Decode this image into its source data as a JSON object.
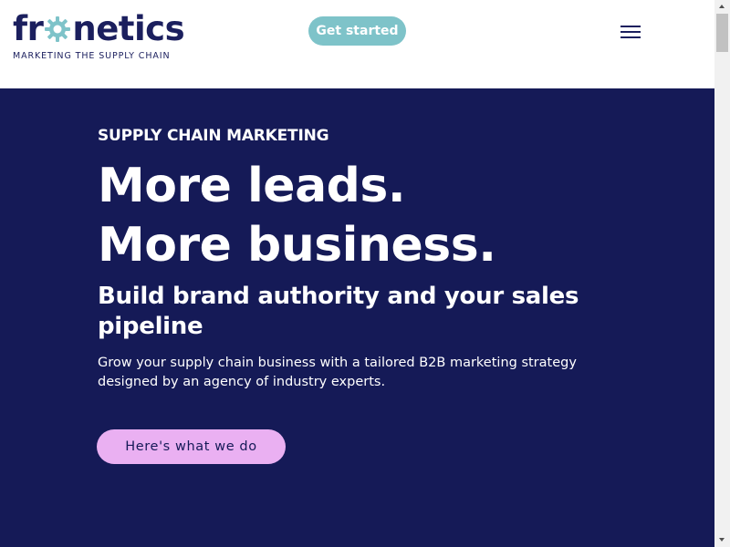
{
  "header": {
    "logo": {
      "prefix": "fr",
      "suffix": "netics",
      "tagline": "MARKETING THE SUPPLY CHAIN",
      "gear_icon": "gear-icon",
      "colors": {
        "text": "#1b1f5e",
        "gear": "#7ec3c9"
      }
    },
    "cta_label": "Get started",
    "menu_icon": "hamburger-menu-icon"
  },
  "hero": {
    "eyebrow": "SUPPLY CHAIN MARKETING",
    "headline_line1": "More leads.",
    "headline_line2": "More business.",
    "subheadline": "Build brand authority and your sales pipeline",
    "body": "Grow your supply chain business with a tailored B2B marketing strategy designed by an agency of industry experts.",
    "cta_label": "Here's what we do"
  },
  "colors": {
    "hero_background": "#151a57",
    "header_cta_background": "#7ec3c9",
    "hero_cta_background": "#eab0f2",
    "text_on_dark": "#ffffff"
  }
}
